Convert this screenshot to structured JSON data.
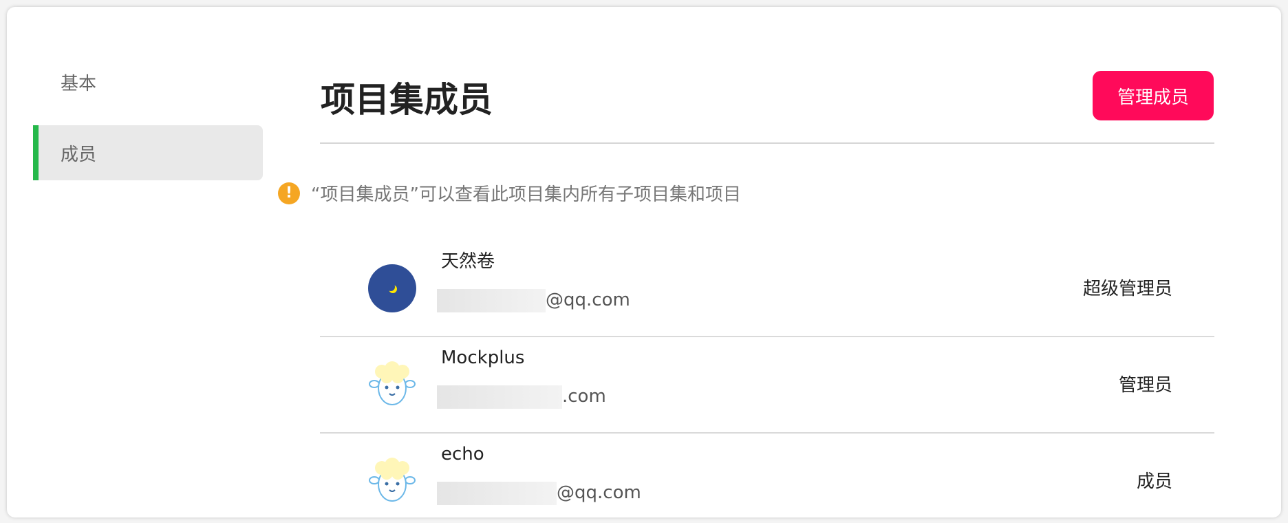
{
  "sidebar": {
    "items": [
      {
        "label": "基本"
      },
      {
        "label": "成员"
      }
    ],
    "active_color": "#25b84a"
  },
  "header": {
    "title": "项目集成员",
    "manage_button": "管理成员",
    "button_color": "#ff0a5a"
  },
  "notice": {
    "icon": "warning-icon",
    "text": "“项目集成员”可以查看此项目集内所有子项目集和项目"
  },
  "members": [
    {
      "name": "天然卷",
      "email_suffix": "@qq.com",
      "role": "超级管理员",
      "avatar": "moon-avatar"
    },
    {
      "name": "Mockplus",
      "email_suffix": ".com",
      "role": "管理员",
      "avatar": "sheep-avatar"
    },
    {
      "name": "echo",
      "email_suffix": "@qq.com",
      "role": "成员",
      "avatar": "sheep-avatar"
    }
  ]
}
